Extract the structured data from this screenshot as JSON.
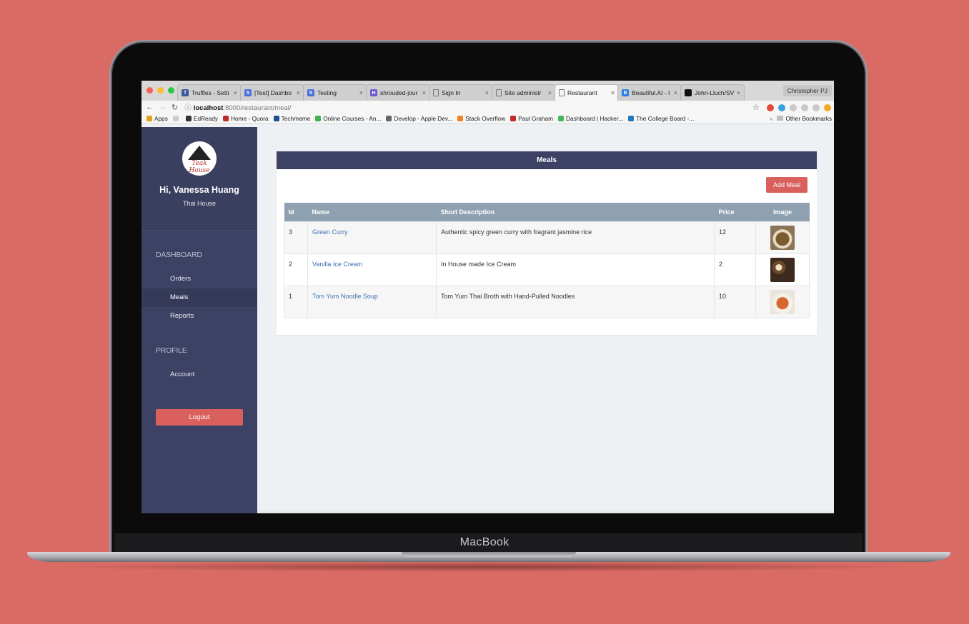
{
  "device": {
    "label": "MacBook"
  },
  "browser": {
    "tabs": [
      {
        "title": "Truffles - Setti",
        "color": "#3b5998",
        "glyph": "f"
      },
      {
        "title": "[Test] Dashbo",
        "color": "#4a6fd9",
        "glyph": "S"
      },
      {
        "title": "Testing",
        "color": "#4a6fd9",
        "glyph": "S"
      },
      {
        "title": "shrouded-jour",
        "color": "#6a5acd",
        "glyph": "H"
      },
      {
        "title": "Sign In",
        "color": "",
        "glyph": ""
      },
      {
        "title": "Site administr",
        "color": "",
        "glyph": ""
      },
      {
        "title": "Restaurant",
        "color": "",
        "glyph": "",
        "active": true
      },
      {
        "title": "Beautiful.AI - I",
        "color": "#2a7de1",
        "glyph": "B"
      },
      {
        "title": "John-Lluch/SV",
        "color": "#111111",
        "glyph": ""
      }
    ],
    "close_glyph": "×",
    "profile_name": "Christopher PJ",
    "url_host": "localhost",
    "url_rest": ":8000/restaurant/meal/",
    "bookmarks": [
      {
        "label": "Apps",
        "color": "#e3a21a"
      },
      {
        "label": "",
        "color": "#cccccc"
      },
      {
        "label": "EdReady",
        "color": "#333333"
      },
      {
        "label": "Home - Quora",
        "color": "#b92b27"
      },
      {
        "label": "Techmeme",
        "color": "#1d4f91"
      },
      {
        "label": "Online Courses - An...",
        "color": "#3fb34f"
      },
      {
        "label": "Develop - Apple Dev...",
        "color": "#666666"
      },
      {
        "label": "Stack Overflow",
        "color": "#f48024"
      },
      {
        "label": "Paul Graham",
        "color": "#c62828"
      },
      {
        "label": "Dashboard | Hacker...",
        "color": "#45b85c"
      },
      {
        "label": "The College Board -...",
        "color": "#1f7ac2"
      }
    ],
    "bookmarks_overflow": "»",
    "other_bookmarks": "Other Bookmarks"
  },
  "sidebar": {
    "greeting": "Hi, Vanessa Huang",
    "restaurant": "Thai House",
    "logo_text": "Teak House",
    "section_dashboard": "DASHBOARD",
    "items": [
      {
        "label": "Orders"
      },
      {
        "label": "Meals",
        "active": true
      },
      {
        "label": "Reports"
      }
    ],
    "section_profile": "PROFILE",
    "account": "Account",
    "logout": "Logout"
  },
  "panel": {
    "title": "Meals",
    "add_button": "Add Meal",
    "columns": [
      "Id",
      "Name",
      "Short Description",
      "Price",
      "Image"
    ],
    "rows": [
      {
        "id": "3",
        "name": "Green Curry",
        "description": "Authentic spicy green curry with fragrant jasmine rice",
        "price": "12",
        "image": "green-curry-photo"
      },
      {
        "id": "2",
        "name": "Vanilla Ice Cream",
        "description": "In House made Ice Cream",
        "price": "2",
        "image": "ice-cream-photo"
      },
      {
        "id": "1",
        "name": "Tom Yum Noodle Soup",
        "description": "Tom Yum Thai Broth with Hand-Pulled Noodles",
        "price": "10",
        "image": "noodle-soup-photo"
      }
    ]
  },
  "colors": {
    "background": "#d96b64",
    "sidebar": "#3d4264",
    "accent_button": "#d9605c",
    "table_header": "#8fa1b1",
    "link": "#3f72b0"
  }
}
